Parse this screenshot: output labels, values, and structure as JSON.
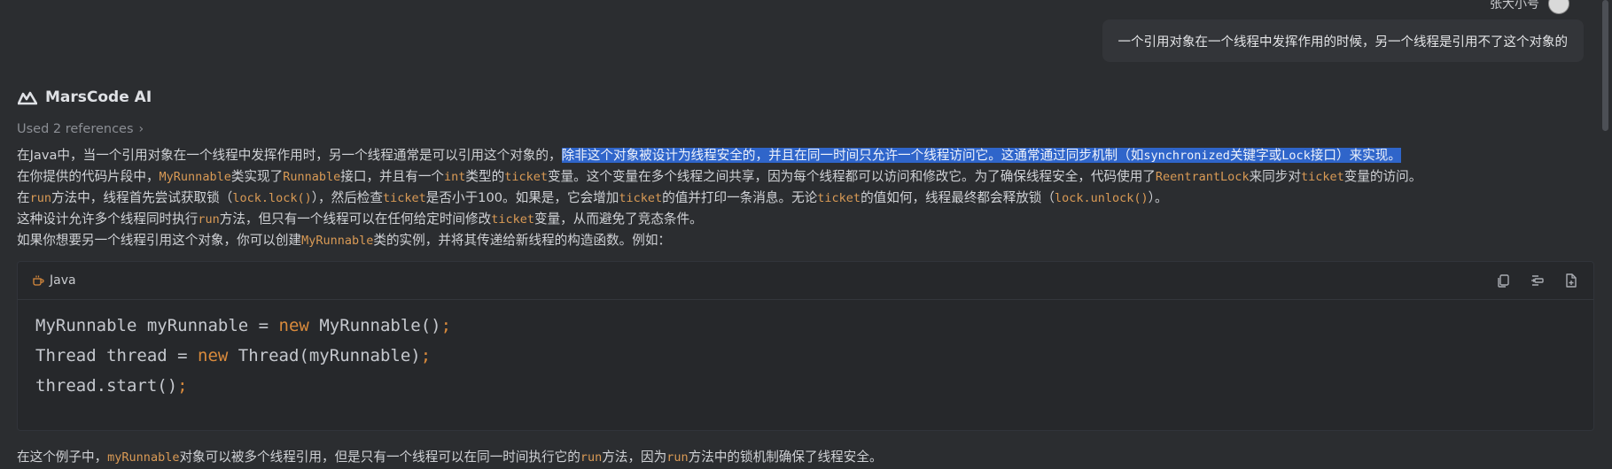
{
  "user": {
    "name": "张大小号",
    "message": "一个引用对象在一个线程中发挥作用的时候，另一个线程是引用不了这个对象的"
  },
  "assistant": {
    "name": "MarsCode AI",
    "references": "Used 2 references",
    "p1": {
      "a": "在Java中，当一个引用对象在一个线程中发挥作用时，另一个线程通常是可以引用这个对象的，",
      "sel_a": "除非这个对象被设计为线程安全的，并且在同一时间只允许一个线程访问它。这通常通过同步机制（如",
      "sel_code1": "synchronized",
      "sel_b": "关键字或",
      "sel_code2": "Lock",
      "sel_c": "接口）来实现。"
    },
    "p2": {
      "a": "在你提供的代码片段中，",
      "c1": "MyRunnable",
      "b": "类实现了",
      "c2": "Runnable",
      "c": "接口，并且有一个",
      "c3": "int",
      "d": "类型的",
      "c4": "ticket",
      "e": "变量。这个变量在多个线程之间共享，因为每个线程都可以访问和修改它。为了确保线程安全，代码使用了",
      "c5": "ReentrantLock",
      "f": "来同步对",
      "c6": "ticket",
      "g": "变量的访问。"
    },
    "p3": {
      "a": "在",
      "c1": "run",
      "b": "方法中，线程首先尝试获取锁（",
      "c2": "lock.lock()",
      "c": "），然后检查",
      "c3": "ticket",
      "d": "是否小于100。如果是，它会增加",
      "c4": "ticket",
      "e": "的值并打印一条消息。无论",
      "c5": "ticket",
      "f": "的值如何，线程最终都会释放锁（",
      "c6": "lock.unlock()",
      "g": "）。"
    },
    "p4": {
      "a": "这种设计允许多个线程同时执行",
      "c1": "run",
      "b": "方法，但只有一个线程可以在任何给定时间修改",
      "c2": "ticket",
      "c": "变量，从而避免了竞态条件。"
    },
    "p5": {
      "a": "如果你想要另一个线程引用这个对象，你可以创建",
      "c1": "MyRunnable",
      "b": "类的实例，并将其传递给新线程的构造函数。例如："
    },
    "code": {
      "language": "Java",
      "line1_a": "MyRunnable myRunnable = ",
      "line1_kw": "new",
      "line1_b": " MyRunnable()",
      "line1_p": ";",
      "line2_a": "Thread thread = ",
      "line2_kw": "new",
      "line2_b": " Thread(myRunnable)",
      "line2_p": ";",
      "line3_a": "thread.start()",
      "line3_p": ";"
    },
    "p6": {
      "a": "在这个例子中，",
      "c1": "myRunnable",
      "b": "对象可以被多个线程引用，但是只有一个线程可以在同一时间执行它的",
      "c2": "run",
      "c": "方法，因为",
      "c3": "run",
      "d": "方法中的锁机制确保了线程安全。"
    }
  },
  "icons": {
    "copy": "copy-icon",
    "insert": "insert-icon",
    "new-file": "new-file-icon",
    "language": "java-cup-icon",
    "logo": "marscode-logo-icon",
    "chevron": "chevron-right-icon"
  },
  "colors": {
    "background": "#2b2d30",
    "code_background": "#26282b",
    "inline_code": "#d99a55",
    "keyword": "#d98a3c",
    "selection": "#2f65ca"
  }
}
